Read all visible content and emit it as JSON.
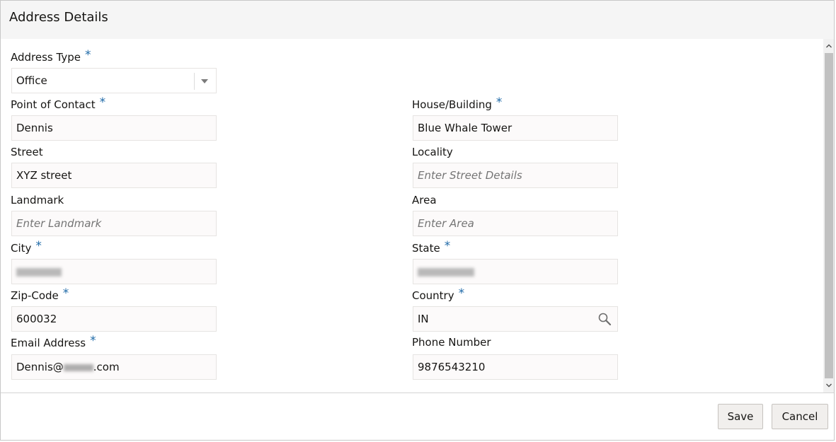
{
  "dialog": {
    "title": "Address Details"
  },
  "fields": {
    "address_type": {
      "label": "Address Type",
      "required": "*",
      "value": "Office"
    },
    "point_of_contact": {
      "label": "Point of Contact",
      "required": "*",
      "value": "Dennis"
    },
    "house_building": {
      "label": "House/Building",
      "required": "*",
      "value": "Blue Whale Tower"
    },
    "street": {
      "label": "Street",
      "value": "XYZ street"
    },
    "locality": {
      "label": "Locality",
      "placeholder": "Enter Street Details"
    },
    "landmark": {
      "label": "Landmark",
      "placeholder": "Enter Landmark"
    },
    "area": {
      "label": "Area",
      "placeholder": "Enter Area"
    },
    "city": {
      "label": "City",
      "required": "*"
    },
    "state": {
      "label": "State",
      "required": "*"
    },
    "zip_code": {
      "label": "Zip-Code",
      "required": "*",
      "value": "600032"
    },
    "country": {
      "label": "Country",
      "required": "*",
      "value": "IN"
    },
    "email_address": {
      "label": "Email Address",
      "required": "*",
      "value_prefix": "Dennis@",
      "value_suffix": ".com"
    },
    "phone_number": {
      "label": "Phone Number",
      "value": "9876543210"
    }
  },
  "footer": {
    "save_label": "Save",
    "cancel_label": "Cancel"
  },
  "icons": {
    "dropdown": "chevron-down-icon",
    "search": "search-icon",
    "scroll_up": "chevron-up-icon",
    "scroll_down": "chevron-down-icon"
  },
  "colors": {
    "required": "#1f6aa8",
    "header_bg": "#f5f5f5",
    "input_bg": "#fcfafa"
  }
}
